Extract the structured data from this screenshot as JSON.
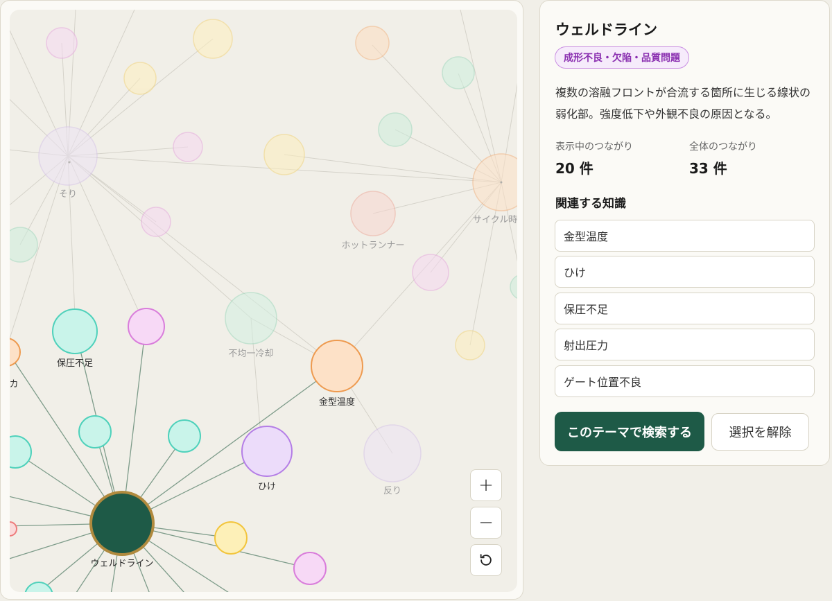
{
  "graph": {
    "node_labels": {
      "sori": "そり",
      "cycle": "サイクル時",
      "hot_runner": "ホットランナー",
      "uneven_cooling": "不均一冷却",
      "hoatsu": "保圧不足",
      "injection": "カ",
      "mold_temp": "金型温度",
      "hike": "ひけ",
      "sori2": "反り",
      "weld": "ウェルドライン"
    },
    "zoom_in_label": "+",
    "zoom_out_label": "−"
  },
  "panel": {
    "title": "ウェルドライン",
    "category": "成形不良・欠陥・品質問題",
    "description": "複数の溶融フロントが合流する箇所に生じる線状の弱化部。強度低下や外観不良の原因となる。",
    "stats": {
      "visible_label": "表示中のつながり",
      "visible_value": "20 件",
      "total_label": "全体のつながり",
      "total_value": "33 件"
    },
    "related_title": "関連する知識",
    "related_items": [
      "金型温度",
      "ひけ",
      "保圧不足",
      "射出圧力",
      "ゲート位置不良"
    ],
    "search_button": "このテーマで検索する",
    "clear_button": "選択を解除"
  }
}
